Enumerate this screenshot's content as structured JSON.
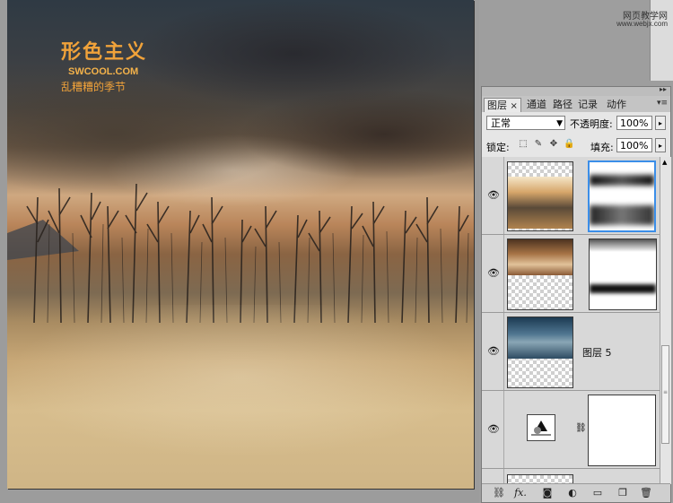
{
  "watermark": {
    "logo_text": "形色主义",
    "site": "SWCOOL.COM",
    "subtitle": "乱糟糟的季节"
  },
  "site_label": {
    "name": "网页教学网",
    "url": "www.webjx.com"
  },
  "layers_panel": {
    "tabs": [
      {
        "label": "图层",
        "active": true
      },
      {
        "label": "通道",
        "active": false
      },
      {
        "label": "路径",
        "active": false
      },
      {
        "label": "记录",
        "active": false
      },
      {
        "label": "动作",
        "active": false
      }
    ],
    "tab_close": "×",
    "blend_mode": "正常",
    "opacity_label": "不透明度:",
    "opacity_value": "100%",
    "lock_label": "锁定:",
    "fill_label": "填充:",
    "fill_value": "100%",
    "layers": [
      {
        "name": "",
        "visible": true,
        "selected": false,
        "type": "image-with-mask"
      },
      {
        "name": "",
        "visible": true,
        "selected": false,
        "type": "image-with-mask"
      },
      {
        "name": "图层 5",
        "visible": true,
        "selected": false,
        "type": "image"
      },
      {
        "name": "",
        "visible": true,
        "selected": false,
        "type": "adjustment-with-mask"
      }
    ],
    "bottom_icons": [
      "link-icon",
      "fx-icon",
      "mask-icon",
      "adjustment-icon",
      "folder-icon",
      "new-layer-icon",
      "trash-icon"
    ],
    "bottom_fx_text": "fx."
  },
  "colors": {
    "watermark": "#f0a23a",
    "selection": "#3b8ee8",
    "panel_bg": "#d6d6d6"
  }
}
